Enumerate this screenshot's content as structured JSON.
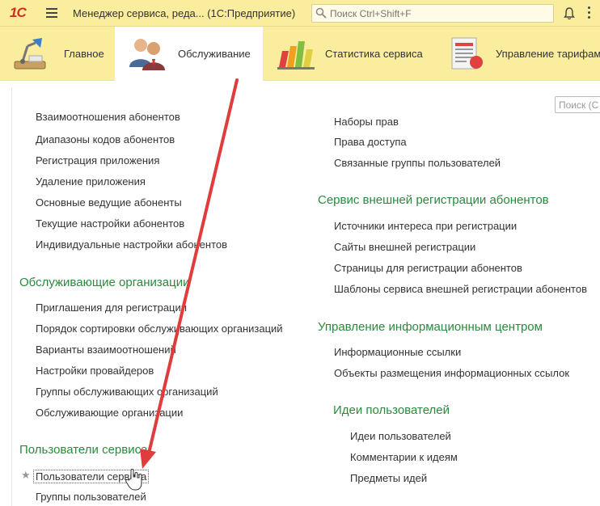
{
  "titlebar": {
    "logo": "1С",
    "title": "Менеджер сервиса, реда...  (1С:Предприятие)",
    "search_placeholder": "Поиск Ctrl+Shift+F"
  },
  "sections": [
    {
      "label": "Главное"
    },
    {
      "label": "Обслуживание"
    },
    {
      "label": "Статистика сервиса"
    },
    {
      "label": "Управление тарифами"
    }
  ],
  "filter": {
    "placeholder": "Поиск (С"
  },
  "left": {
    "top_items": [
      "Взаимоотношения абонентов",
      "Диапазоны кодов абонентов",
      "Регистрация приложения",
      "Удаление приложения",
      "Основные ведущие абоненты",
      "Текущие настройки абонентов",
      "Индивидуальные настройки абонентов"
    ],
    "group1": {
      "title": "Обслуживающие организации",
      "items": [
        "Приглашения для регистрации",
        "Порядок сортировки обслуживающих организаций",
        "Варианты взаимоотношений",
        "Настройки провайдеров",
        "Группы обслуживающих организаций",
        "Обслуживающие организации"
      ]
    },
    "group2": {
      "title": "Пользователи сервиса",
      "items": [
        "Пользователи сервиса",
        "Группы пользователей"
      ]
    }
  },
  "right": {
    "top_items": [
      "Наборы прав",
      "Права доступа",
      "Связанные группы пользователей"
    ],
    "group1": {
      "title": "Сервис внешней регистрации абонентов",
      "items": [
        "Источники интереса при регистрации",
        "Сайты внешней регистрации",
        "Страницы для регистрации абонентов",
        "Шаблоны сервиса внешней регистрации абонентов"
      ]
    },
    "group2": {
      "title": "Управление информационным центром",
      "items": [
        "Информационные ссылки",
        "Объекты размещения информационных ссылок"
      ]
    },
    "group3": {
      "title": "Идеи пользователей",
      "items": [
        "Идеи пользователей",
        "Комментарии к идеям",
        "Предметы идей"
      ]
    }
  },
  "colors": {
    "header_bg": "#fbed9e",
    "group_title": "#2a8a3e",
    "arrow": "#e03c3c"
  }
}
